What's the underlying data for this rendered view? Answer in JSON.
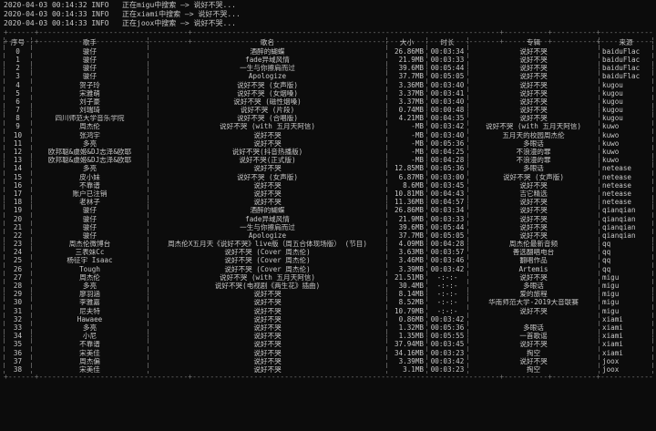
{
  "logs": [
    {
      "time": "2020-04-03 00:14:32 INFO",
      "msg": "正在migu中搜索 —> 说好不哭..."
    },
    {
      "time": "2020-04-03 00:14:33 INFO",
      "msg": "正在xiami中搜索 —> 说好不哭..."
    },
    {
      "time": "2020-04-03 00:14:33 INFO",
      "msg": "正在joox中搜索 —> 说好不哭..."
    }
  ],
  "headers": {
    "index": "序号",
    "singer": "歌手",
    "song": "歌名",
    "size": "大小",
    "duration": "时长",
    "album": "专辑",
    "source": "来源"
  },
  "rows": [
    [
      "0",
      "骏仔",
      "酒醉的蝴蝶",
      "26.86MB",
      "00:03:34",
      "说好不哭",
      "baiduFlac"
    ],
    [
      "1",
      "骏仔",
      "fade异域风情",
      "21.9MB",
      "00:03:33",
      "说好不哭",
      "baiduFlac"
    ],
    [
      "2",
      "骏仔",
      "一生与你擦肩而过",
      "39.6MB",
      "00:05:44",
      "说好不哭",
      "baiduFlac"
    ],
    [
      "3",
      "骏仔",
      "Apologize",
      "37.7MB",
      "00:05:05",
      "说好不哭",
      "baiduFlac"
    ],
    [
      "4",
      "贺子玲",
      "说好不哭 (女声版)",
      "3.36MB",
      "00:03:40",
      "说好不哭",
      "kugou"
    ],
    [
      "5",
      "宋雅萌",
      "说好不哭 (女烟嗓)",
      "3.37MB",
      "00:03:41",
      "说好不哭",
      "kugou"
    ],
    [
      "6",
      "刘子豪",
      "说好不哭 (磁性烟嗓)",
      "3.37MB",
      "00:03:40",
      "说好不哭",
      "kugou"
    ],
    [
      "7",
      "刘瑞琦",
      "说好不哭 (片段)",
      "0.74MB",
      "00:00:48",
      "说好不哭",
      "kugou"
    ],
    [
      "8",
      "四川师范大学音乐学院",
      "说好不哭 (合唱版)",
      "4.21MB",
      "00:04:35",
      "说好不哭",
      "kugou"
    ],
    [
      "9",
      "周杰伦",
      "说好不哭 (with 五月天阿信)",
      "-MB",
      "00:03:42",
      "说好不哭 (with 五月天阿信)",
      "kuwo"
    ],
    [
      "10",
      "张鸿宇",
      "说好不哭",
      "-MB",
      "00:03:40",
      "五月天的校园周杰伦",
      "kuwo"
    ],
    [
      "11",
      "多亮",
      "说好不哭",
      "-MB",
      "00:05:36",
      "多眼话",
      "kuwo"
    ],
    [
      "12",
      "欧邦聪&虞姬&DJ志泽&欧耶",
      "说好不哭(抖音热播版)",
      "-MB",
      "00:04:25",
      "不浪漫的罪",
      "kuwo"
    ],
    [
      "13",
      "欧邦聪&虞姬&DJ志泽&欧耶",
      "说好不哭(正式版)",
      "-MB",
      "00:04:28",
      "不浪漫的罪",
      "kuwo"
    ],
    [
      "14",
      "多亮",
      "说好不哭",
      "12.85MB",
      "00:05:36",
      "多眼话",
      "netease"
    ],
    [
      "15",
      "皮小妹",
      "说好不哭 (女声版)",
      "6.87MB",
      "00:03:00",
      "说好不哭 (女声版)",
      "netease"
    ],
    [
      "16",
      "不靠谱",
      "说好不哭",
      "8.6MB",
      "00:03:45",
      "说好不哭",
      "netease"
    ],
    [
      "17",
      "账户已注销",
      "说好不哭",
      "10.81MB",
      "00:04:43",
      "吉它精选",
      "netease"
    ],
    [
      "18",
      "老林子",
      "说好不哭",
      "11.36MB",
      "00:04:57",
      "说好不哭",
      "netease"
    ],
    [
      "19",
      "骏仔",
      "酒醉的蝴蝶",
      "26.86MB",
      "00:03:34",
      "说好不哭",
      "qianqian"
    ],
    [
      "20",
      "骏仔",
      "fade异域风情",
      "21.9MB",
      "00:03:33",
      "说好不哭",
      "qianqian"
    ],
    [
      "21",
      "骏仔",
      "一生与你擦肩而过",
      "39.6MB",
      "00:05:44",
      "说好不哭",
      "qianqian"
    ],
    [
      "22",
      "骏仔",
      "Apologize",
      "37.7MB",
      "00:05:05",
      "说好不哭",
      "qianqian"
    ],
    [
      "23",
      "周杰伦微博台",
      "周杰伦X五月天《说好不哭》live版（周五合体现场版） (节目)",
      "4.09MB",
      "00:04:28",
      "周杰伦最新音频",
      "qq"
    ],
    [
      "24",
      "三表妹Cc",
      "说好不哭 (Cover 周杰伦)",
      "3.63MB",
      "00:03:57",
      "善选翻唱电台",
      "qq"
    ],
    [
      "25",
      "杨征宇 Isaac",
      "说好不哭 (Cover 周杰伦)",
      "3.46MB",
      "00:03:46",
      "翻唱作品",
      "qq"
    ],
    [
      "26",
      "Tough",
      "说好不哭 (Cover 周杰伦)",
      "3.39MB",
      "00:03:42",
      "Artemis",
      "qq"
    ],
    [
      "27",
      "周杰伦",
      "说好不哭 (with 五月天阿信)",
      "21.51MB",
      "-:-:-",
      "说好不哭",
      "migu"
    ],
    [
      "28",
      "多亮",
      "说好不哭(电视剧《两生花》插曲)",
      "30.4MB",
      "-:-:-",
      "多眼话",
      "migu"
    ],
    [
      "29",
      "廖羽涵",
      "说好不哭",
      "8.14MB",
      "-:-:-",
      "爱的旅程",
      "migu"
    ],
    [
      "30",
      "李雅嘉",
      "说好不哭",
      "8.52MB",
      "-:-:-",
      "华南师范大学-2019大音联赛",
      "migu"
    ],
    [
      "31",
      "尼夫特",
      "说好不哭",
      "10.79MB",
      "-:-:-",
      "说好不哭",
      "migu"
    ],
    [
      "32",
      "Hawaee",
      "说好不哭",
      "0.86MB",
      "00:03:42",
      "",
      "xiami"
    ],
    [
      "33",
      "多亮",
      "说好不哭",
      "1.32MB",
      "00:05:36",
      "多眼话",
      "xiami"
    ],
    [
      "34",
      "小尼",
      "说好不哭",
      "1.35MB",
      "00:05:55",
      "一首歌谣",
      "xiami"
    ],
    [
      "35",
      "不靠谱",
      "说好不哭",
      "37.94MB",
      "00:03:45",
      "说好不哭",
      "xiami"
    ],
    [
      "36",
      "宋美佳",
      "说好不哭",
      "34.16MB",
      "00:03:23",
      "掏空",
      "xiami"
    ],
    [
      "37",
      "周杰偏",
      "说好不哭",
      "3.39MB",
      "00:03:42",
      "说好不哭",
      "joox"
    ],
    [
      "38",
      "宋美佳",
      "说好不哭",
      "3.1MB",
      "00:03:23",
      "掏空",
      "joox"
    ]
  ]
}
